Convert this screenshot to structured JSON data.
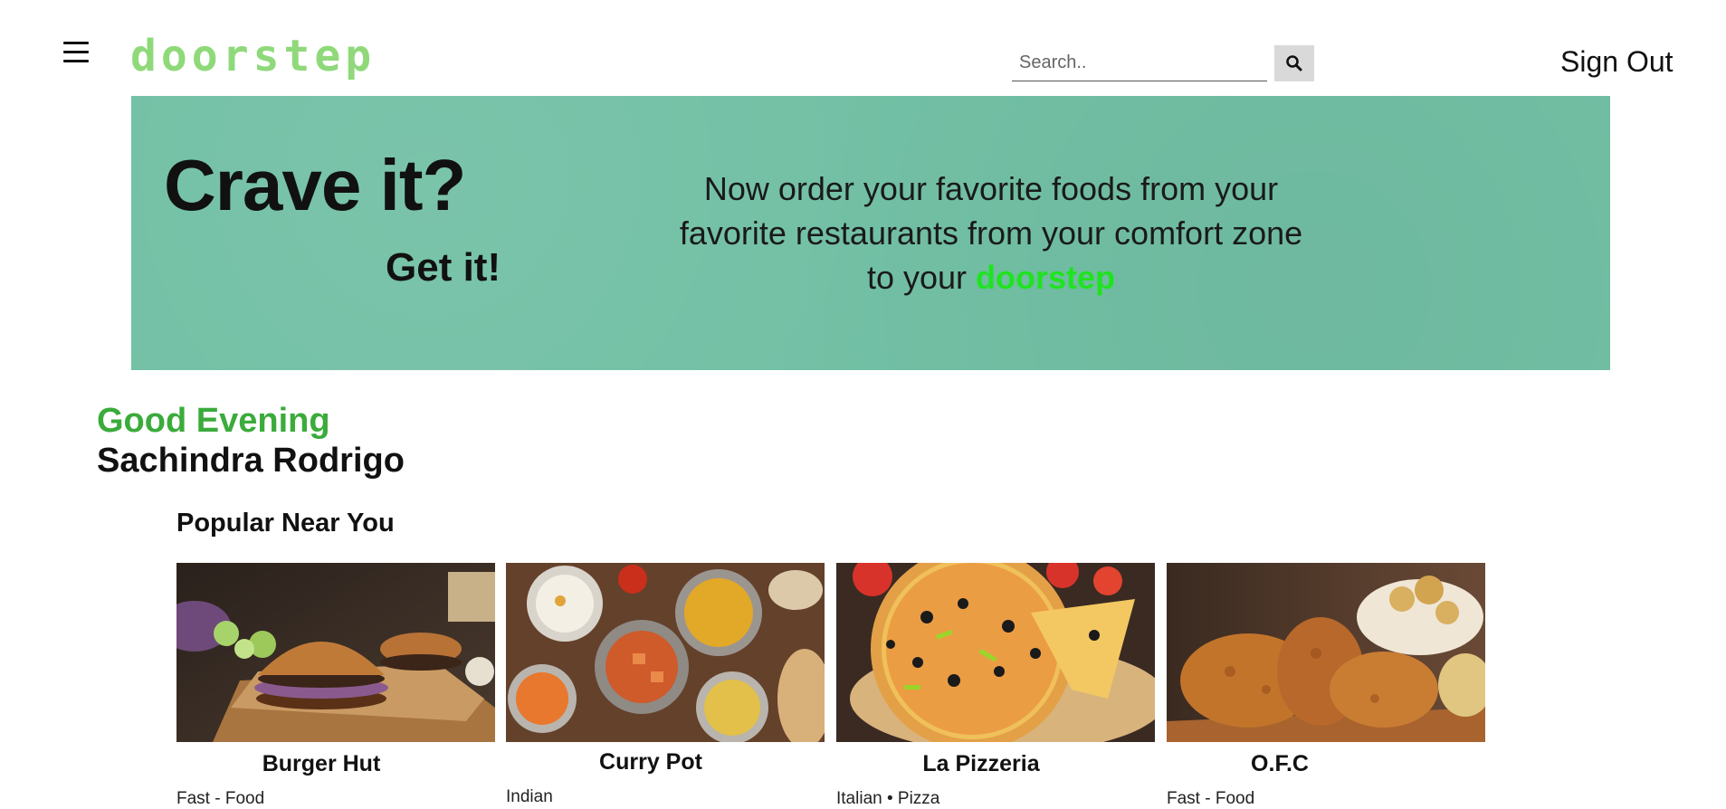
{
  "header": {
    "logo": "doorstep",
    "search_placeholder": "Search..",
    "sign_out": "Sign Out"
  },
  "banner": {
    "headline": "Crave it?",
    "subheadline": "Get it!",
    "tagline_line1": "Now order your favorite foods from your",
    "tagline_line2": "favorite restaurants from your comfort zone",
    "tagline_line3": "to your",
    "brand": "doorstep"
  },
  "greeting": {
    "salutation": "Good Evening",
    "name": "Sachindra Rodrigo"
  },
  "popular": {
    "title": "Popular Near You",
    "restaurants": [
      {
        "name": "Burger Hut",
        "category": "Fast - Food"
      },
      {
        "name": "Curry Pot",
        "category": "Indian"
      },
      {
        "name": "La Pizzeria",
        "category": "Italian • Pizza"
      },
      {
        "name": "O.F.C",
        "category": "Fast - Food"
      }
    ]
  },
  "colors": {
    "logo": "#8fd97a",
    "banner_bg": "#72c0a5",
    "greeting": "#3bab3b",
    "brand_inline": "#1fe31f"
  }
}
